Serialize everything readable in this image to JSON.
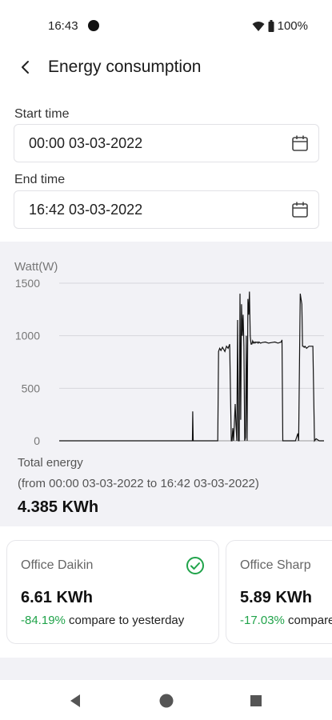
{
  "status_bar": {
    "time": "16:43",
    "battery": "100%"
  },
  "header": {
    "title": "Energy consumption"
  },
  "start_time": {
    "label": "Start time",
    "value": "00:00 03-03-2022"
  },
  "end_time": {
    "label": "End time",
    "value": "16:42 03-03-2022"
  },
  "chart_data": {
    "type": "line",
    "ylabel": "Watt(W)",
    "ylim": [
      0,
      1500
    ],
    "yticks": [
      "1500",
      "1000",
      "500",
      "0"
    ],
    "grid": true,
    "xlim": [
      0,
      16.7
    ],
    "series": [
      {
        "color": "#111111",
        "x": [
          0,
          8.4,
          8.42,
          8.45,
          8.48,
          10.0,
          10.05,
          10.12,
          10.2,
          10.3,
          10.45,
          10.55,
          10.65,
          10.75,
          10.85,
          10.9,
          10.95,
          11.0,
          11.1,
          11.15,
          11.2,
          11.25,
          11.3,
          11.35,
          11.4,
          11.45,
          11.5,
          11.55,
          11.6,
          11.65,
          11.7,
          11.75,
          11.8,
          11.85,
          11.9,
          11.95,
          12.0,
          12.05,
          12.1,
          12.15,
          12.2,
          12.25,
          12.3,
          12.35,
          12.4,
          12.45,
          12.5,
          12.55,
          12.6,
          12.7,
          12.8,
          13.0,
          13.2,
          13.4,
          13.6,
          13.8,
          14.0,
          14.05,
          14.1,
          14.2,
          14.5,
          14.9,
          15.05,
          15.1,
          15.2,
          15.3,
          15.35,
          15.4,
          15.45,
          15.5,
          15.6,
          15.75,
          16.0,
          16.1,
          16.2,
          16.4,
          16.7
        ],
        "y": [
          0,
          0,
          280,
          0,
          0,
          0,
          850,
          880,
          860,
          890,
          850,
          900,
          880,
          920,
          0,
          0,
          120,
          0,
          350,
          150,
          0,
          1150,
          0,
          0,
          1400,
          200,
          1300,
          1000,
          1200,
          900,
          0,
          30,
          1000,
          0,
          1350,
          1200,
          1420,
          1000,
          920,
          920,
          950,
          930,
          940,
          930,
          940,
          935,
          940,
          930,
          940,
          930,
          935,
          940,
          930,
          935,
          940,
          930,
          940,
          960,
          0,
          0,
          0,
          0,
          70,
          0,
          1400,
          1300,
          900,
          900,
          890,
          900,
          880,
          900,
          900,
          0,
          20,
          0,
          0
        ]
      }
    ]
  },
  "total": {
    "label": "Total energy",
    "range": "(from 00:00 03-03-2022 to 16:42 03-03-2022)",
    "value": "4.385 KWh"
  },
  "cards": [
    {
      "name": "Office Daikin",
      "value": "6.61 KWh",
      "pct": "-84.19%",
      "suffix": " compare to yesterday",
      "icon": "check-circle-icon"
    },
    {
      "name": "Office Sharp",
      "value": "5.89 KWh",
      "pct": "-17.03%",
      "suffix": " compare to yesterday"
    }
  ],
  "colors": {
    "accent_green": "#20a34a",
    "panel_bg": "#f2f2f6"
  }
}
